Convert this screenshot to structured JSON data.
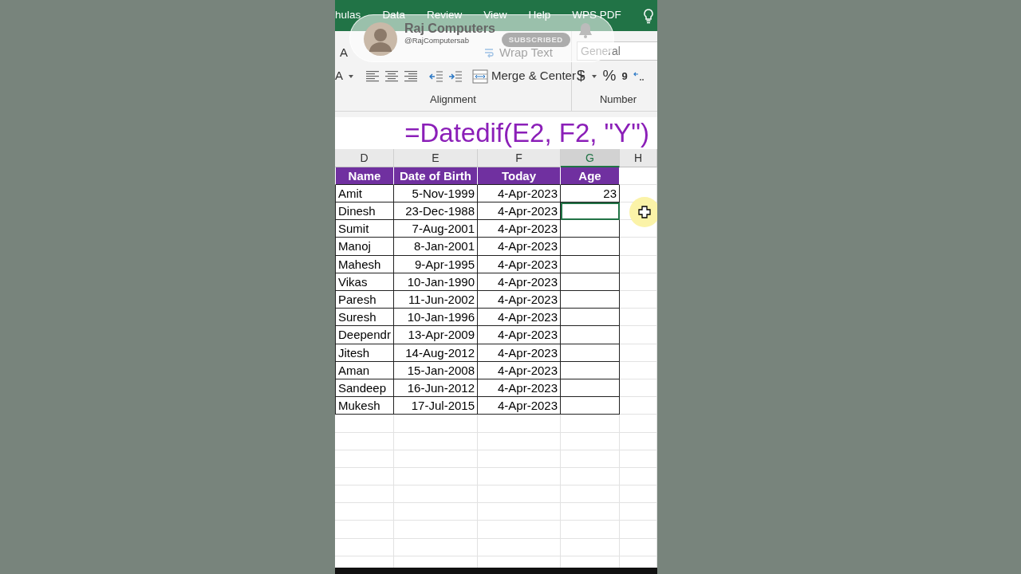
{
  "ribbon_tabs": [
    "hulas",
    "Data",
    "Review",
    "View",
    "Help",
    "WPS PDF"
  ],
  "ribbon": {
    "font_glyphs": [
      "A",
      "A"
    ],
    "wrap_text": "Wrap Text",
    "number_format": "General",
    "merge_button": "Merge & Center",
    "currency": "$",
    "percent": "%",
    "comma": "9",
    "groups": [
      "Alignment",
      "Number"
    ]
  },
  "channel_overlay": {
    "name": "Raj Computers",
    "handle": "@RajComputersab",
    "button": "SUBSCRIBED"
  },
  "formula_caption": "=Datedif(E2, F2, \"Y\")",
  "columns": [
    {
      "label": "D",
      "selected": false
    },
    {
      "label": "E",
      "selected": false
    },
    {
      "label": "F",
      "selected": false
    },
    {
      "label": "G",
      "selected": true
    },
    {
      "label": "H",
      "selected": false
    }
  ],
  "table_header": [
    "Name",
    "Date of Birth",
    "Today",
    "Age"
  ],
  "rows": [
    {
      "cells": [
        "Amit",
        "5-Nov-1999",
        "4-Apr-2023",
        "23"
      ],
      "age_selected": false
    },
    {
      "cells": [
        "Dinesh",
        "23-Dec-1988",
        "4-Apr-2023"
      ],
      "age_selected": true
    },
    {
      "cells": [
        "Sumit",
        "7-Aug-2001",
        "4-Apr-2023"
      ],
      "age_selected": false
    },
    {
      "cells": [
        "Manoj",
        "8-Jan-2001",
        "4-Apr-2023"
      ],
      "age_selected": false
    },
    {
      "cells": [
        "Mahesh",
        "9-Apr-1995",
        "4-Apr-2023"
      ],
      "age_selected": false
    },
    {
      "cells": [
        "Vikas",
        "10-Jan-1990",
        "4-Apr-2023"
      ],
      "age_selected": false
    },
    {
      "cells": [
        "Paresh",
        "11-Jun-2002",
        "4-Apr-2023"
      ],
      "age_selected": false
    },
    {
      "cells": [
        "Suresh",
        "10-Jan-1996",
        "4-Apr-2023"
      ],
      "age_selected": false
    },
    {
      "cells": [
        "Deependr",
        "13-Apr-2009",
        "4-Apr-2023"
      ],
      "age_selected": false
    },
    {
      "cells": [
        "Jitesh",
        "14-Aug-2012",
        "4-Apr-2023"
      ],
      "age_selected": false
    },
    {
      "cells": [
        "Aman",
        "15-Jan-2008",
        "4-Apr-2023"
      ],
      "age_selected": false
    },
    {
      "cells": [
        "Sandeep",
        "16-Jun-2012",
        "4-Apr-2023"
      ],
      "age_selected": false
    },
    {
      "cells": [
        "Mukesh",
        "17-Jul-2015",
        "4-Apr-2023"
      ],
      "age_selected": false
    }
  ]
}
